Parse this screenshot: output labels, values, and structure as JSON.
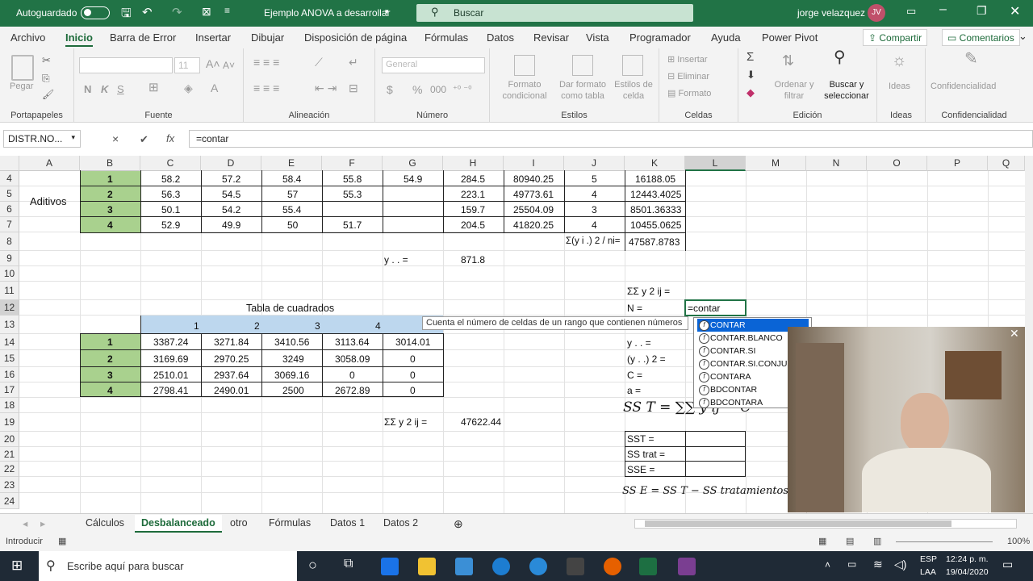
{
  "titlebar": {
    "autosave": "Autoguardado",
    "doc_title": "Ejemplo ANOVA a desarrollar",
    "search": "Buscar",
    "user": "jorge velazquez",
    "initials": "JV"
  },
  "menu": {
    "tabs": [
      "Archivo",
      "Inicio",
      "Barra de Error",
      "Insertar",
      "Dibujar",
      "Disposición de página",
      "Fórmulas",
      "Datos",
      "Revisar",
      "Vista",
      "Programador",
      "Ayuda",
      "Power Pivot"
    ],
    "share": "Compartir",
    "comments": "Comentarios"
  },
  "ribbon": {
    "paste": "Pegar",
    "font_size": "11",
    "bold": "N",
    "italic": "K",
    "underline": "S",
    "number_format": "General",
    "cond_format": "Formato condicional",
    "table_format": "Dar formato como tabla",
    "cell_styles": "Estilos de celda",
    "insert": "Insertar",
    "delete": "Eliminar",
    "format": "Formato",
    "sort": "Ordenar y filtrar",
    "find": "Buscar y seleccionar",
    "ideas": "Ideas",
    "confidentiality": "Confidencialidad",
    "groups": {
      "clipboard": "Portapapeles",
      "font": "Fuente",
      "alignment": "Alineación",
      "number": "Número",
      "styles": "Estilos",
      "cells": "Celdas",
      "editing": "Edición",
      "ideas": "Ideas",
      "confidentiality": "Confidencialidad"
    }
  },
  "formula_bar": {
    "name_box": "DISTR.NO...",
    "cancel": "×",
    "enter": "✔",
    "fx": "fx",
    "content": "=contar"
  },
  "columns": [
    "A",
    "B",
    "C",
    "D",
    "E",
    "F",
    "G",
    "H",
    "I",
    "J",
    "K",
    "L",
    "M",
    "N",
    "O",
    "P",
    "Q"
  ],
  "rows": [
    "4",
    "5",
    "6",
    "7",
    "8",
    "9",
    "10",
    "11",
    "12",
    "13",
    "14",
    "15",
    "16",
    "17",
    "18",
    "19",
    "20",
    "21",
    "22",
    "23",
    "24"
  ],
  "cells": {
    "a5": "Aditivos",
    "t1": [
      "1",
      "58.2",
      "57.2",
      "58.4",
      "55.8",
      "54.9",
      "284.5",
      "80940.25",
      "5",
      "16188.05"
    ],
    "t2": [
      "2",
      "56.3",
      "54.5",
      "57",
      "55.3",
      "",
      "223.1",
      "49773.61",
      "4",
      "12443.4025"
    ],
    "t3": [
      "3",
      "50.1",
      "54.2",
      "55.4",
      "",
      "",
      "159.7",
      "25504.09",
      "3",
      "8501.36333"
    ],
    "t4": [
      "4",
      "52.9",
      "49.9",
      "50",
      "51.7",
      "",
      "204.5",
      "41820.25",
      "4",
      "10455.0625"
    ],
    "k8_label": "Σ(y i .) 2 / ni=",
    "k8": "47587.8783",
    "g9": "y . . =",
    "h9": "871.8",
    "k11": "ΣΣ y 2 ij =",
    "sq_title": "Tabla de cuadrados",
    "sq_head": [
      "1",
      "2",
      "3",
      "4"
    ],
    "s1": [
      "1",
      "3387.24",
      "3271.84",
      "3410.56",
      "3113.64",
      "3014.01"
    ],
    "s2": [
      "2",
      "3169.69",
      "2970.25",
      "3249",
      "3058.09",
      "0"
    ],
    "s3": [
      "3",
      "2510.01",
      "2937.64",
      "3069.16",
      "0",
      "0"
    ],
    "s4": [
      "4",
      "2798.41",
      "2490.01",
      "2500",
      "2672.89",
      "0"
    ],
    "k12": "N =",
    "l12": "=contar",
    "k14": "y . . =",
    "k15": "(y . .) 2 =",
    "k16": "C =",
    "k17": "a =",
    "g19": "ΣΣ y 2 ij =",
    "h19": "47622.44",
    "sst_formula": "SS T = ∑∑ y ij − C",
    "k20": "SST =",
    "k21": "SS trat =",
    "k22": "SSE =",
    "sse_formula": "SS E = SS T − SS tratamientos"
  },
  "autocomplete": {
    "tooltip": "Cuenta el número de celdas de un rango que contienen números",
    "items": [
      "CONTAR",
      "CONTAR.BLANCO",
      "CONTAR.SI",
      "CONTAR.SI.CONJUNTO",
      "CONTARA",
      "BDCONTAR",
      "BDCONTARA"
    ]
  },
  "sheets": [
    "Cálculos",
    "Desbalanceado",
    "otro",
    "Fórmulas",
    "Datos 1",
    "Datos 2"
  ],
  "status": {
    "mode": "Introducir",
    "zoom": "100%"
  },
  "taskbar": {
    "search": "Escribe aquí para buscar",
    "lang": "ESP",
    "lang2": "LAA",
    "time": "12:24 p. m.",
    "date": "19/04/2020"
  }
}
